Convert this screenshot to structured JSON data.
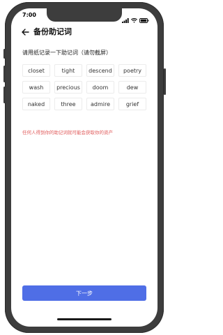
{
  "status_bar": {
    "time": "7:00",
    "icons": [
      "signal-icon",
      "wifi-icon",
      "battery-icon"
    ]
  },
  "header": {
    "back_icon": "arrow-left-icon",
    "title": "备份助记词"
  },
  "instruction": "请用纸记录一下助记词（请勿截屏）",
  "mnemonic_words": [
    "closet",
    "tight",
    "descend",
    "poetry",
    "wash",
    "precious",
    "doom",
    "dew",
    "naked",
    "three",
    "admire",
    "grief"
  ],
  "warning": "任何人得到你的助记词就可能会获取你的资产",
  "next_button": "下一步",
  "colors": {
    "accent": "#4f6ee6",
    "warning": "#e05a5a",
    "frame": "#3d3d3d"
  }
}
